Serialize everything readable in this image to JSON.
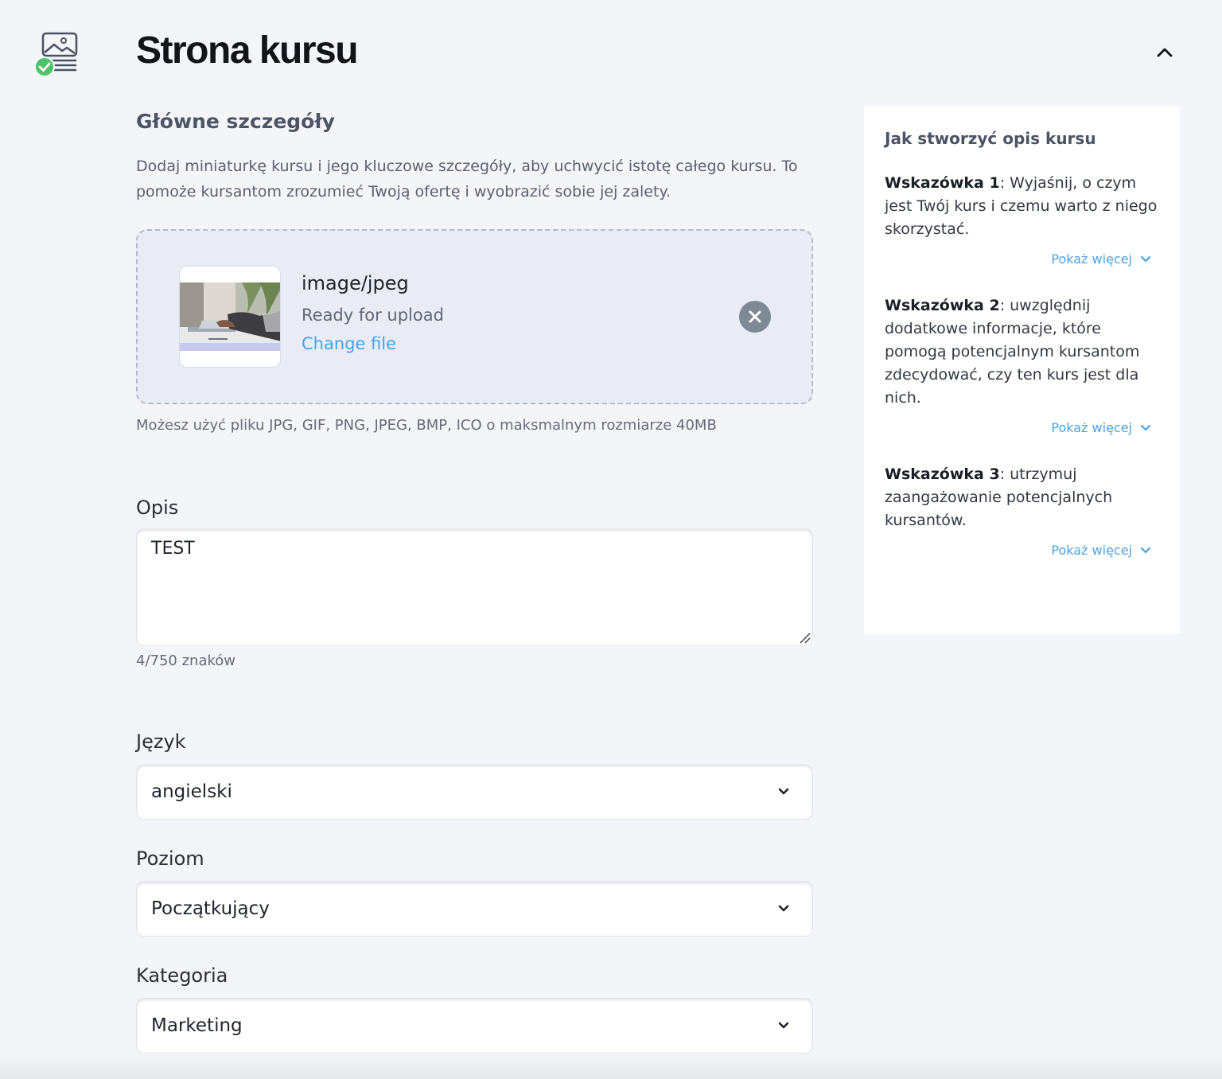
{
  "header": {
    "title": "Strona kursu"
  },
  "main": {
    "subtitle": "Główne szczegóły",
    "intro": "Dodaj miniaturkę kursu i jego kluczowe szczegóły, aby uchwycić istotę całego kursu. To pomoże kursantom zrozumieć Twoją ofertę i wyobrazić sobie jej zalety.",
    "upload": {
      "file_type": "image/jpeg",
      "status": "Ready for upload",
      "change_label": "Change file",
      "hint": "Możesz użyć pliku JPG, GIF, PNG, JPEG, BMP, ICO o maksmalnym rozmiarze 40MB"
    },
    "description": {
      "label": "Opis",
      "value": "TEST",
      "count": "4/750 znaków"
    },
    "language": {
      "label": "Język",
      "value": "angielski"
    },
    "level": {
      "label": "Poziom",
      "value": "Początkujący"
    },
    "category": {
      "label": "Kategoria",
      "value": "Marketing"
    }
  },
  "tips": {
    "title": "Jak stworzyć opis kursu",
    "items": [
      {
        "heading": "Wskazówka 1",
        "text": ": Wyjaśnij, o czym jest Twój kurs i czemu warto z niego skorzystać.",
        "more": "Pokaż więcej"
      },
      {
        "heading": "Wskazówka 2",
        "text": ": uwzględnij dodatkowe informacje, które pomogą potencjalnym kursantom zdecydować, czy ten kurs jest dla nich.",
        "more": "Pokaż więcej"
      },
      {
        "heading": "Wskazówka 3",
        "text": ": utrzymuj zaangażowanie potencjalnych kursantów.",
        "more": "Pokaż więcej"
      }
    ]
  },
  "colors": {
    "accent": "#4ba2e3",
    "success": "#4cc26a",
    "background": "#f4f5f8"
  }
}
